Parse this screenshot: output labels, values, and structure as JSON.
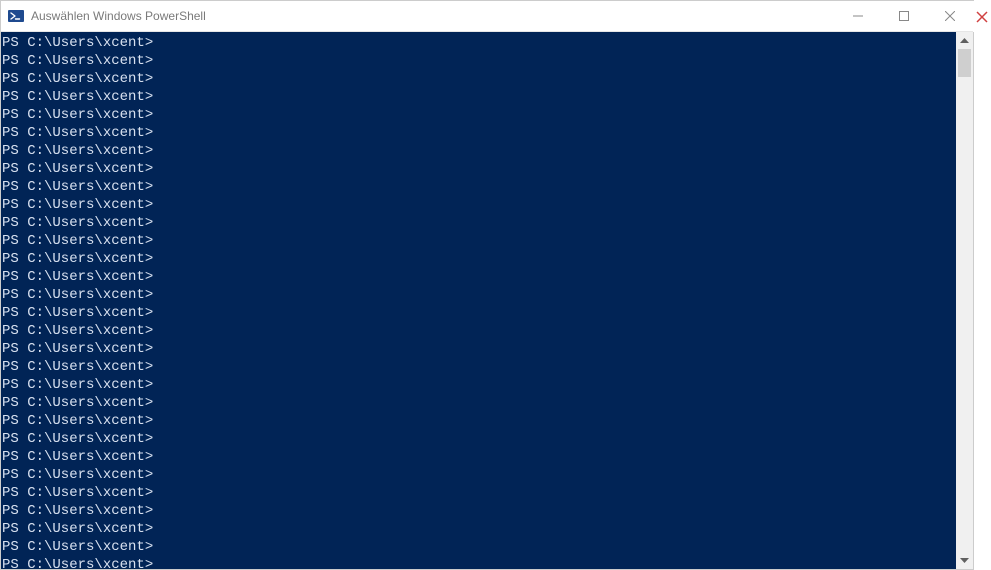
{
  "titlebar": {
    "title": "Auswählen Windows PowerShell",
    "icon_name": "powershell-icon",
    "minimize_label": "—",
    "maximize_label": "",
    "close_label": "✕"
  },
  "terminal": {
    "prompt": "PS C:\\Users\\xcent>",
    "line_count": 30,
    "colors": {
      "background": "#012456",
      "foreground": "#d8e1f0"
    }
  },
  "scrollbar": {
    "thumb_position": "top"
  },
  "outer": {
    "partial_close_x": "✕"
  }
}
